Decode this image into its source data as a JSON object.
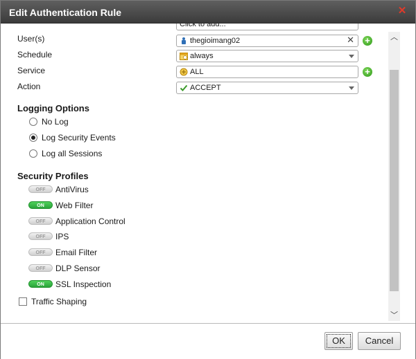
{
  "dialog": {
    "title": "Edit Authentication Rule"
  },
  "form": {
    "partial_field": {
      "value": "Click to add..."
    },
    "users": {
      "label": "User(s)",
      "value": "thegioimang02"
    },
    "schedule": {
      "label": "Schedule",
      "value": "always"
    },
    "service": {
      "label": "Service",
      "value": "ALL"
    },
    "action": {
      "label": "Action",
      "value": "ACCEPT"
    }
  },
  "logging": {
    "title": "Logging Options",
    "options": [
      {
        "label": "No Log",
        "selected": false
      },
      {
        "label": "Log Security Events",
        "selected": true
      },
      {
        "label": "Log all Sessions",
        "selected": false
      }
    ]
  },
  "security": {
    "title": "Security Profiles",
    "on_label": "ON",
    "off_label": "OFF",
    "profiles": [
      {
        "label": "AntiVirus",
        "state": "OFF"
      },
      {
        "label": "Web Filter",
        "state": "ON"
      },
      {
        "label": "Application Control",
        "state": "OFF"
      },
      {
        "label": "IPS",
        "state": "OFF"
      },
      {
        "label": "Email Filter",
        "state": "OFF"
      },
      {
        "label": "DLP Sensor",
        "state": "OFF"
      },
      {
        "label": "SSL Inspection",
        "state": "ON"
      }
    ]
  },
  "traffic_shaping": {
    "label": "Traffic Shaping",
    "checked": false
  },
  "buttons": {
    "ok": "OK",
    "cancel": "Cancel"
  },
  "colors": {
    "toggle_on": "#2aa33a",
    "add_button": "#2f9a1a",
    "close": "#e03a2a",
    "titlebar": "#3b3b3b"
  }
}
